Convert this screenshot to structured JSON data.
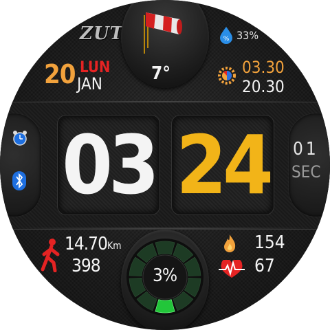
{
  "brand": "ZUT",
  "weather": {
    "temperature": "7°",
    "icon": "windsock-icon"
  },
  "humidity": {
    "value": "33%",
    "icon": "water-drop-percent-icon"
  },
  "date": {
    "day": "20",
    "weekday": "LUN",
    "month": "JAN"
  },
  "sun": {
    "sunrise": "03.30",
    "sunset": "20.30",
    "icon": "sun-gear-icon"
  },
  "time": {
    "hours": "03",
    "minutes": "24",
    "seconds": "01",
    "seconds_label": "SEC"
  },
  "activity": {
    "distance": "14.70",
    "distance_unit": "Km",
    "steps": "398",
    "icon": "walking-person-icon"
  },
  "health": {
    "calories": "154",
    "heart_rate": "67"
  },
  "battery": {
    "percent_text": "3%",
    "level": 0.03
  },
  "colors": {
    "accent": "#f2b418",
    "orange": "#f2a23c",
    "red": "#e52323",
    "green": "#22c63a",
    "blue": "#1e6fe0"
  }
}
